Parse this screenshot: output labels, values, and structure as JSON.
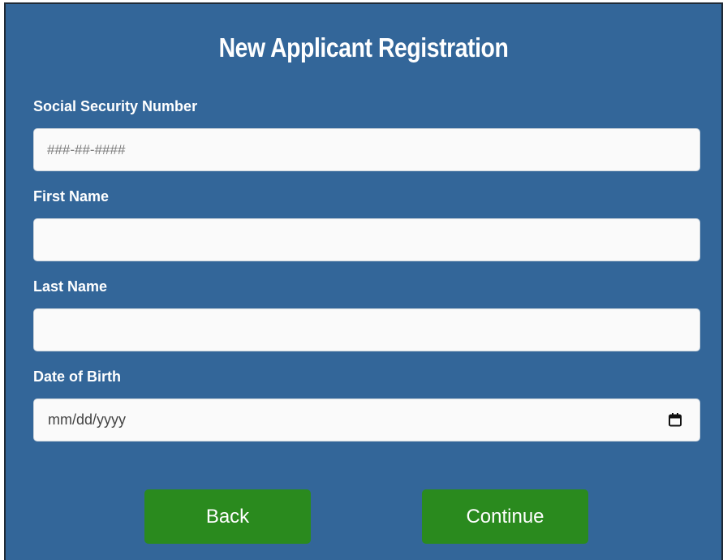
{
  "form": {
    "title": "New Applicant Registration",
    "ssn": {
      "label": "Social Security Number",
      "placeholder": "###-##-####",
      "value": ""
    },
    "first_name": {
      "label": "First Name",
      "placeholder": "",
      "value": ""
    },
    "last_name": {
      "label": "Last Name",
      "placeholder": "",
      "value": ""
    },
    "dob": {
      "label": "Date of Birth",
      "placeholder": "mm/dd/yyyy",
      "icon": "calendar-icon"
    },
    "buttons": {
      "back": "Back",
      "continue": "Continue"
    }
  },
  "colors": {
    "background": "#336699",
    "button": "#2a8a1e",
    "field": "#fafafa",
    "text": "#ffffff"
  }
}
